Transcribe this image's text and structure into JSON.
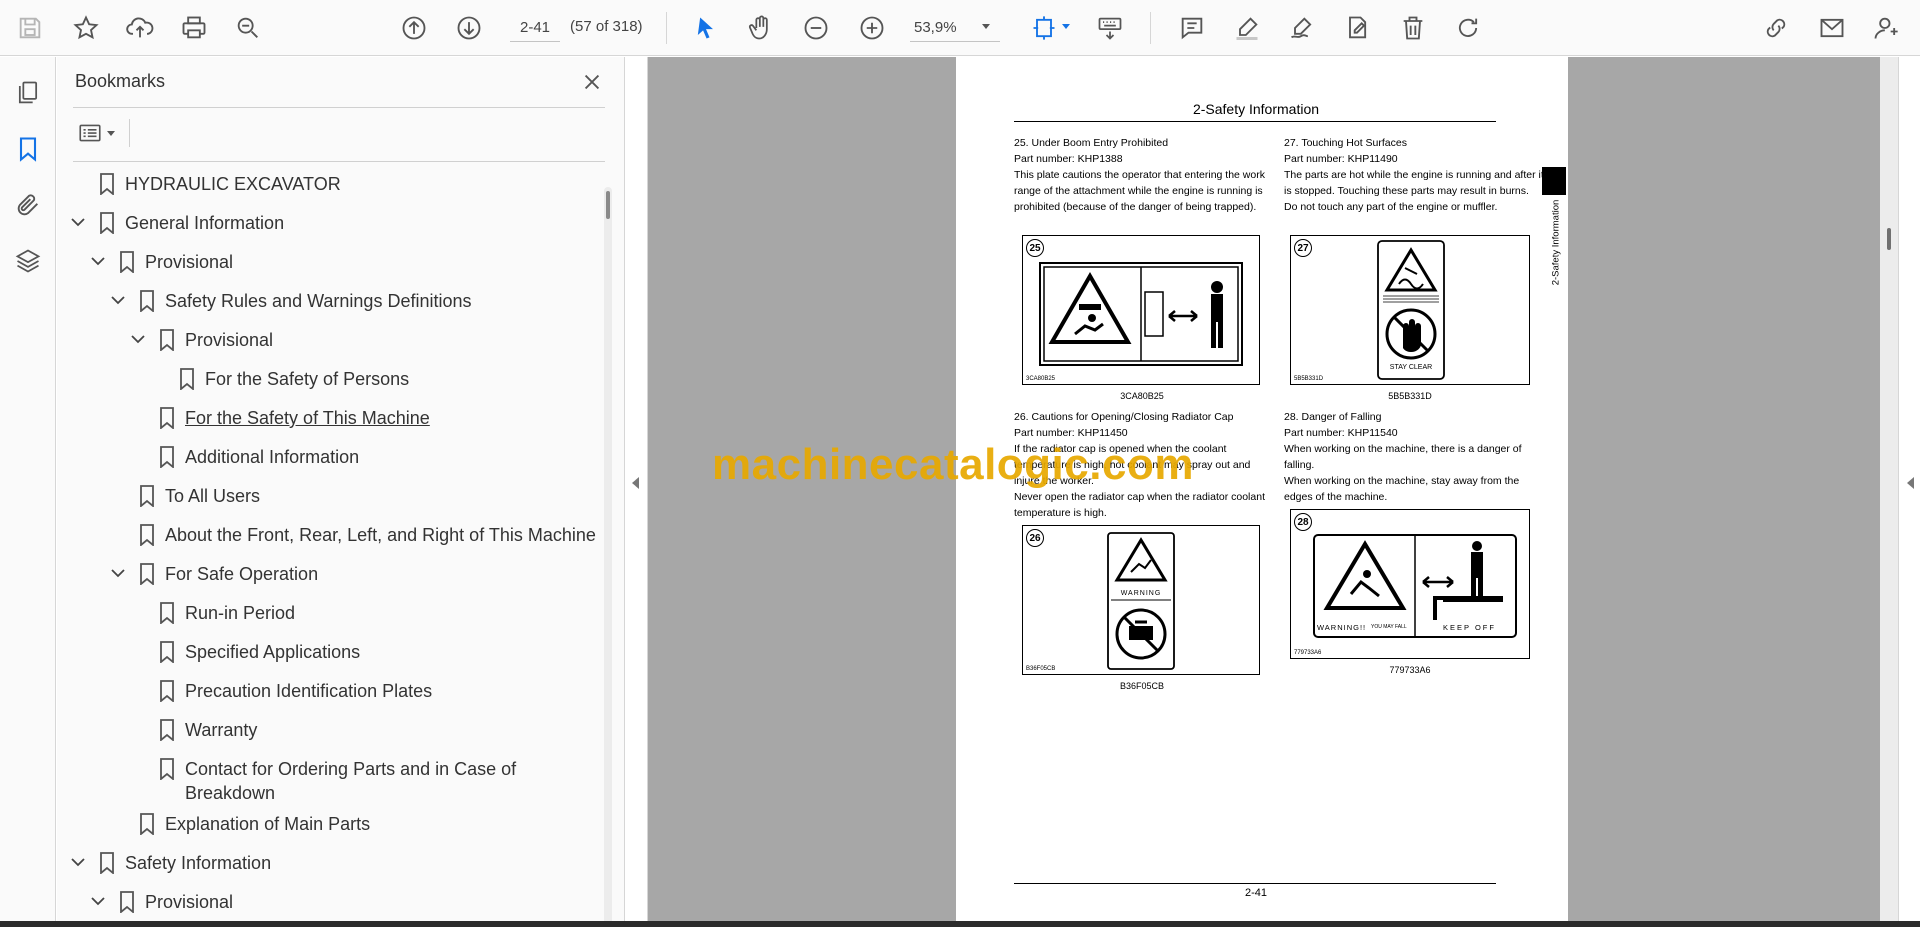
{
  "toolbar": {
    "page_field": "2-41",
    "page_count": "(57 of 318)",
    "zoom": "53,9%"
  },
  "icons": [
    "save-icon",
    "star-icon",
    "upload-icon",
    "print-icon",
    "zoom-search-icon",
    "page-up-icon",
    "page-down-icon",
    "hand-icon",
    "select-arrow-icon",
    "zoom-out-icon",
    "zoom-in-icon",
    "fit-icon",
    "keyboard-icon",
    "comment-icon",
    "highlight-icon",
    "sign-icon",
    "stamp-icon",
    "delete-icon",
    "redo-icon",
    "share-link-icon",
    "mail-icon",
    "account-icon"
  ],
  "colors": {
    "accent": "#1473e6",
    "watermark": "#e8a900"
  },
  "panel": {
    "title": "Bookmarks",
    "items": [
      {
        "label": "HYDRAULIC EXCAVATOR"
      },
      {
        "label": "General Information"
      },
      {
        "label": "Provisional"
      },
      {
        "label": "Safety Rules and Warnings Definitions"
      },
      {
        "label": "Provisional"
      },
      {
        "label": "For the Safety of Persons"
      },
      {
        "label": "For the Safety of This Machine"
      },
      {
        "label": "Additional Information"
      },
      {
        "label": "To All Users"
      },
      {
        "label": "About the Front, Rear, Left, and Right of This Machine"
      },
      {
        "label": "For Safe Operation"
      },
      {
        "label": "Run-in Period"
      },
      {
        "label": "Specified Applications"
      },
      {
        "label": "Precaution Identification Plates"
      },
      {
        "label": "Warranty"
      },
      {
        "label": "Contact for Ordering Parts and in Case of Breakdown"
      },
      {
        "label": "Explanation of Main Parts"
      },
      {
        "label": "Safety Information"
      },
      {
        "label": "Provisional"
      }
    ]
  },
  "page": {
    "header": "2-Safety Information",
    "side_tab": "2-Safety Information",
    "footer": "2-41",
    "sections": [
      {
        "title": "25. Under Boom Entry Prohibited",
        "part": "Part number: KHP1388",
        "body": [
          "This plate cautions the operator that entering the work range of the attachment while the engine is running is prohibited (because of the danger of being trapped)."
        ],
        "fig_num": "25",
        "fig_code": "3CA80B25",
        "caption": "3CA80B25"
      },
      {
        "title": "27. Touching Hot Surfaces",
        "part": "Part number: KHP11490",
        "body": [
          "The parts are hot while the engine is running and after it is stopped. Touching these parts may result in burns.",
          "Do not touch any part of the engine or muffler."
        ],
        "fig_num": "27",
        "fig_code": "5B5B331D",
        "caption": "5B5B331D",
        "label_text": "STAY CLEAR"
      },
      {
        "title": "26. Cautions for Opening/Closing Radiator Cap",
        "part": "Part number: KHP11450",
        "body": [
          "If the radiator cap is opened when the coolant temperature is high, hot coolant may spray out and injure the worker.",
          "Never open the radiator cap when the radiator coolant temperature is high."
        ],
        "fig_num": "26",
        "fig_code": "B36F05CB",
        "caption": "B36F05CB",
        "label_text": "WARNING"
      },
      {
        "title": "28. Danger of Falling",
        "part": "Part number: KHP11540",
        "body": [
          "When working on the machine, there is a danger of falling.",
          "When working on the machine, stay away from the edges of the machine."
        ],
        "fig_num": "28",
        "fig_code": "779733A6",
        "caption": "779733A6",
        "label_text": "WARNING!!",
        "label_text_2": "YOU MAY FALL",
        "label_text_3": "KEEP OFF"
      }
    ]
  },
  "watermark": "machinecatalogic.com"
}
